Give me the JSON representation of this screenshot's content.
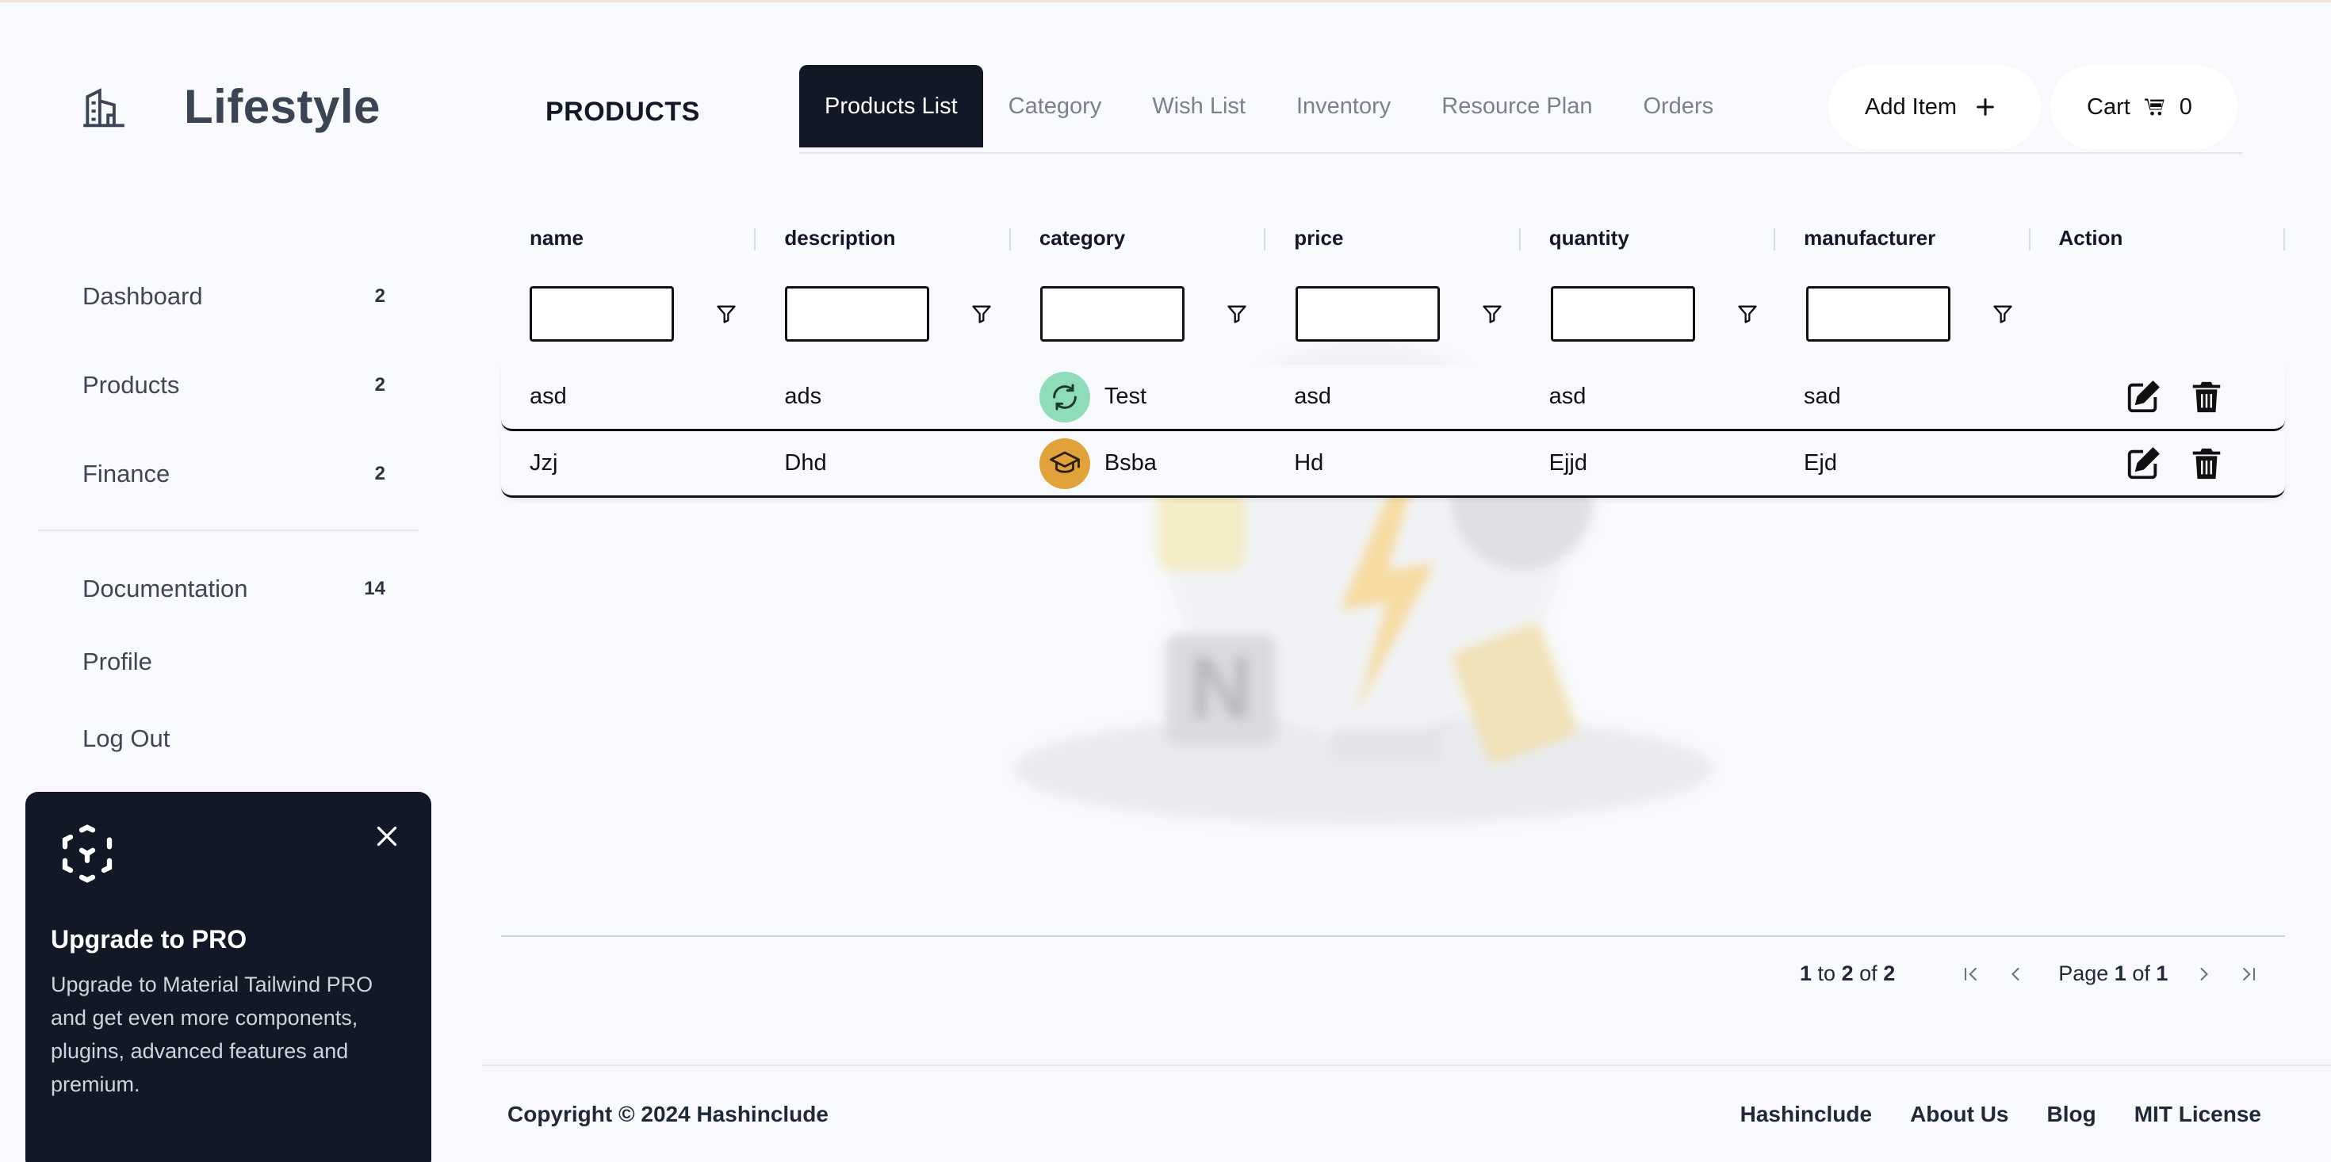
{
  "app": {
    "brand": "Lifestyle",
    "page_title": "PRODUCTS"
  },
  "sidebar": {
    "items": [
      {
        "label": "Dashboard",
        "count": "2"
      },
      {
        "label": "Products",
        "count": "2"
      },
      {
        "label": "Finance",
        "count": "2"
      }
    ],
    "secondary": [
      {
        "label": "Documentation",
        "count": "14"
      },
      {
        "label": "Profile"
      },
      {
        "label": "Log Out"
      }
    ]
  },
  "promo": {
    "title": "Upgrade to PRO",
    "text": "Upgrade to Material Tailwind PRO and get even more components, plugins, advanced features and premium."
  },
  "tabs": [
    {
      "label": "Products List",
      "active": true
    },
    {
      "label": "Category"
    },
    {
      "label": "Wish List"
    },
    {
      "label": "Inventory"
    },
    {
      "label": "Resource Plan"
    },
    {
      "label": "Orders"
    }
  ],
  "header": {
    "add_label": "Add Item",
    "cart_label": "Cart",
    "cart_count": "0"
  },
  "table": {
    "columns": [
      "name",
      "description",
      "category",
      "price",
      "quantity",
      "manufacturer",
      "Action"
    ],
    "rows": [
      {
        "name": "asd",
        "description": "ads",
        "category": "Test",
        "category_icon": "refresh-icon",
        "category_color": "#8fdcb8",
        "price": "asd",
        "quantity": "asd",
        "manufacturer": "sad"
      },
      {
        "name": "Jzj",
        "description": "Dhd",
        "category": "Bsba",
        "category_icon": "graduation-cap-icon",
        "category_color": "#e1a23a",
        "price": "Hd",
        "quantity": "Ejjd",
        "manufacturer": "Ejd"
      }
    ]
  },
  "pagination": {
    "from": "1",
    "to_word": "to",
    "to": "2",
    "of_word": "of",
    "total": "2",
    "page_word": "Page",
    "page": "1",
    "pages": "1"
  },
  "footer": {
    "copyright": "Copyright © 2024 Hashinclude",
    "links": [
      "Hashinclude",
      "About Us",
      "Blog",
      "MIT License"
    ]
  },
  "colors": {
    "dark": "#121826",
    "background": "#f8f9fc"
  }
}
